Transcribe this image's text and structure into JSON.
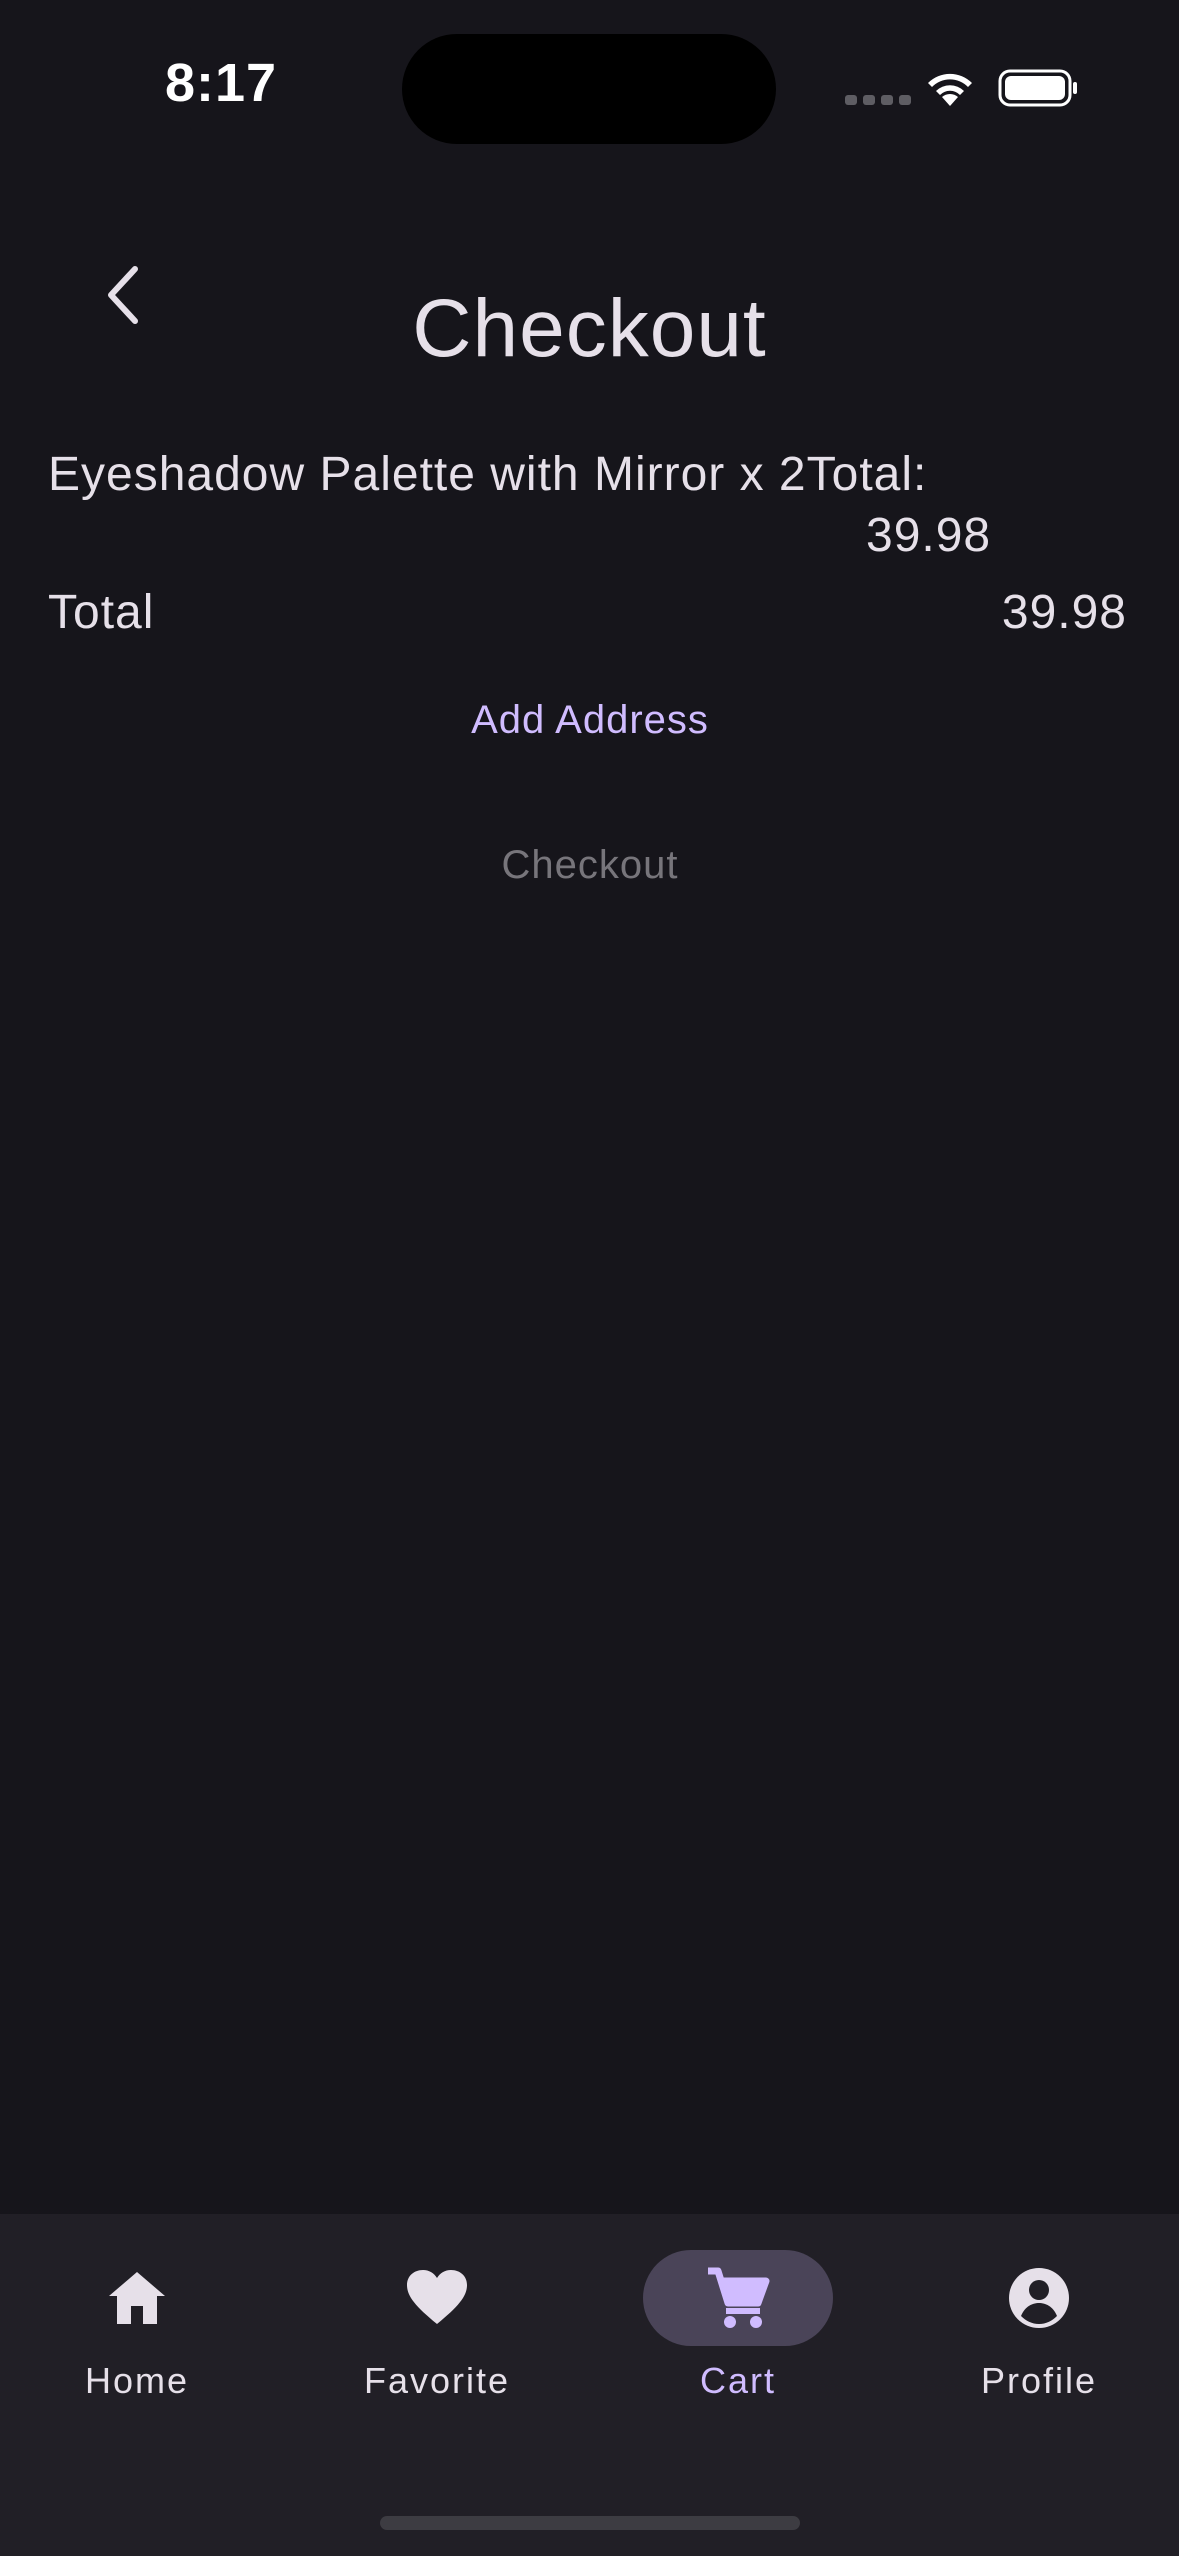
{
  "status_bar": {
    "time": "8:17"
  },
  "header": {
    "title": "Checkout",
    "back_icon": "chevron-left-icon"
  },
  "order": {
    "item_text": "Eyeshadow Palette with Mirror x 2Total:",
    "item_price": "39.98",
    "total_label": "Total",
    "total_value": "39.98"
  },
  "actions": {
    "add_address_label": "Add Address",
    "checkout_label": "Checkout"
  },
  "bottom_nav": {
    "items": [
      {
        "label": "Home",
        "icon": "home-icon"
      },
      {
        "label": "Favorite",
        "icon": "heart-icon"
      },
      {
        "label": "Cart",
        "icon": "cart-icon",
        "selected": true
      },
      {
        "label": "Profile",
        "icon": "account-circle-icon"
      }
    ]
  },
  "colors": {
    "background": "#16151b",
    "nav_background": "#211f26",
    "accent": "#d0bcff",
    "active_pill": "#4a4458",
    "text_primary": "#e6e0e9",
    "text_disabled": "#77757b"
  }
}
